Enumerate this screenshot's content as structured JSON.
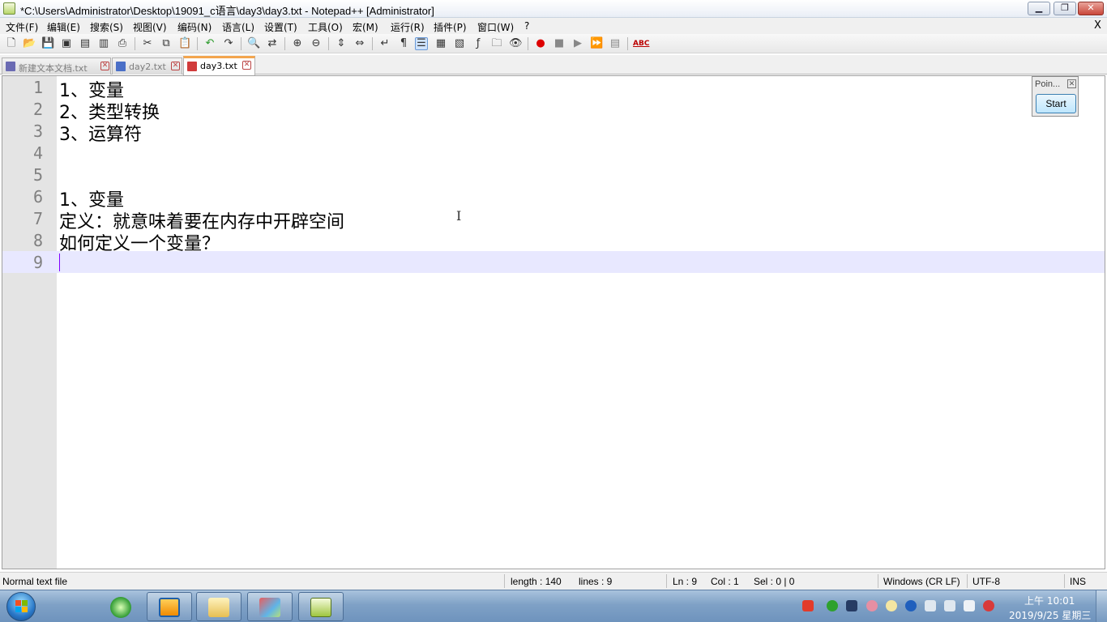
{
  "window": {
    "title": "*C:\\Users\\Administrator\\Desktop\\19091_c语言\\day3\\day3.txt - Notepad++ [Administrator]",
    "min_glyph": "▁",
    "max_glyph": "❐",
    "close_glyph": "✕"
  },
  "menu": {
    "items": [
      "文件(F)",
      "编辑(E)",
      "搜索(S)",
      "视图(V)",
      "编码(N)",
      "语言(L)",
      "设置(T)",
      "工具(O)",
      "宏(M)",
      "运行(R)",
      "插件(P)",
      "窗口(W)",
      "?"
    ],
    "close_doc": "X"
  },
  "toolbar": {
    "icons": [
      "new-file-icon",
      "open-file-icon",
      "save-icon",
      "save-all-icon",
      "close-icon",
      "close-all-icon",
      "print-icon",
      "cut-icon",
      "copy-icon",
      "paste-icon",
      "undo-icon",
      "redo-icon",
      "find-icon",
      "replace-icon",
      "zoom-in-icon",
      "zoom-out-icon",
      "sync-v-icon",
      "sync-h-icon",
      "wrap-icon",
      "show-all-chars-icon",
      "indent-guide-icon",
      "udl-icon",
      "doc-map-icon",
      "function-list-icon",
      "folder-workspace-icon",
      "monitor-icon",
      "record-macro-icon",
      "stop-macro-icon",
      "play-macro-icon",
      "run-macro-multiple-icon",
      "save-macro-icon",
      "spell-check-icon"
    ],
    "spell_check_label": "ABC"
  },
  "tabs": [
    {
      "label": "新建文本文档.txt",
      "icon_color": "#6b6bb3",
      "active": false
    },
    {
      "label": "day2.txt",
      "icon_color": "#4a6fc7",
      "active": false
    },
    {
      "label": "day3.txt",
      "icon_color": "#d13b3b",
      "active": true
    }
  ],
  "tab_close_glyph": "✕",
  "editor": {
    "lines": [
      {
        "num": "1",
        "text": "1、变量"
      },
      {
        "num": "2",
        "text": "2、类型转换"
      },
      {
        "num": "3",
        "text": "3、运算符"
      },
      {
        "num": "4",
        "text": ""
      },
      {
        "num": "5",
        "text": ""
      },
      {
        "num": "6",
        "text": "1、变量"
      },
      {
        "num": "7",
        "text": "定义：就意味着要在内存中开辟空间"
      },
      {
        "num": "8",
        "text": "如何定义一个变量？"
      },
      {
        "num": "9",
        "text": ""
      }
    ],
    "current_line": 9
  },
  "plugin_panel": {
    "title": "Poin...",
    "close_glyph": "✕",
    "start_label": "Start"
  },
  "status": {
    "file_type": "Normal text file",
    "length": "length : 140",
    "lines": "lines : 9",
    "ln": "Ln : 9",
    "col": "Col : 1",
    "sel": "Sel : 0 | 0",
    "eol": "Windows (CR LF)",
    "encoding": "UTF-8",
    "mode": "INS"
  },
  "taskbar": {
    "apps": [
      "ie-icon",
      "outlook-icon",
      "explorer-icon",
      "paint-icon",
      "notepadpp-icon"
    ],
    "tray_icons": [
      "sogou-input-icon",
      "360-icon",
      "app-tray-icon",
      "flower-icon",
      "cloud-icon",
      "bluetooth-icon",
      "usb-icon",
      "network-icon",
      "volume-muted-icon",
      "dots-icon"
    ],
    "time": "上午 10:01",
    "date": "2019/9/25 星期三"
  }
}
